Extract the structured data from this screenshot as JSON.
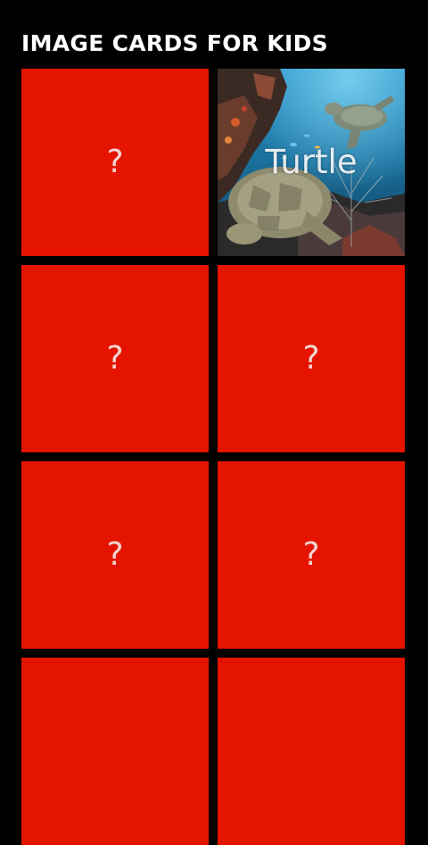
{
  "header": {
    "title": "IMAGE CARDS FOR KIDS"
  },
  "colors": {
    "card_back": "#e51400",
    "background": "#000000",
    "title_text": "#ffffff"
  },
  "cards": [
    {
      "label": "?",
      "state": "hidden"
    },
    {
      "label": "Turtle",
      "state": "revealed",
      "image": "sea-turtle-underwater-photo"
    },
    {
      "label": "?",
      "state": "hidden"
    },
    {
      "label": "?",
      "state": "hidden"
    },
    {
      "label": "?",
      "state": "hidden"
    },
    {
      "label": "?",
      "state": "hidden"
    },
    {
      "label": "",
      "state": "hidden"
    },
    {
      "label": "",
      "state": "hidden"
    }
  ]
}
